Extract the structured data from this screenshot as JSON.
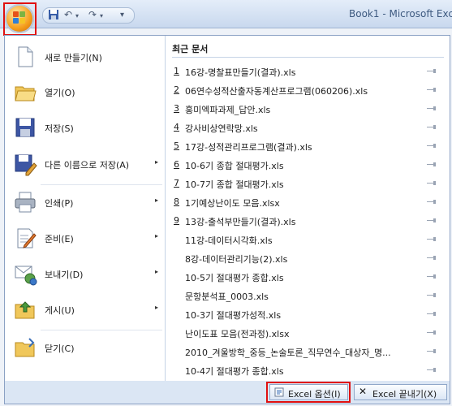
{
  "window": {
    "title": "Book1 - Microsoft Exce"
  },
  "quick_access": {
    "save_icon": "save-icon",
    "undo_icon": "undo-icon",
    "redo_icon": "redo-icon",
    "dropdown_glyph": "▾"
  },
  "left_menu": {
    "items": [
      {
        "label": "새로 만들기(N)",
        "icon": "new-document-icon",
        "has_submenu": false
      },
      {
        "label": "열기(O)",
        "icon": "folder-open-icon",
        "has_submenu": false
      },
      {
        "label": "저장(S)",
        "icon": "floppy-disk-icon",
        "has_submenu": false
      },
      {
        "label": "다른 이름으로 저장(A)",
        "icon": "save-as-icon",
        "has_submenu": true
      },
      {
        "label": "인쇄(P)",
        "icon": "printer-icon",
        "has_submenu": true
      },
      {
        "label": "준비(E)",
        "icon": "prepare-document-icon",
        "has_submenu": true
      },
      {
        "label": "보내기(D)",
        "icon": "send-icon",
        "has_submenu": true
      },
      {
        "label": "게시(U)",
        "icon": "publish-folder-icon",
        "has_submenu": true
      },
      {
        "label": "닫기(C)",
        "icon": "close-folder-icon",
        "has_submenu": false
      }
    ],
    "submenu_arrow": "▸"
  },
  "recent": {
    "header": "최근 문서",
    "items": [
      {
        "num": "1",
        "name": "16강-명찰표만들기(결과).xls"
      },
      {
        "num": "2",
        "name": "06연수성적산출자동계산프로그램(060206).xls"
      },
      {
        "num": "3",
        "name": "홍미엑파과제_답안.xls"
      },
      {
        "num": "4",
        "name": "강사비상연락망.xls"
      },
      {
        "num": "5",
        "name": "17강-성적관리프로그램(결과).xls"
      },
      {
        "num": "6",
        "name": "10-6기 종합 절대평가.xls"
      },
      {
        "num": "7",
        "name": "10-7기 종합 절대평가.xls"
      },
      {
        "num": "8",
        "name": "1기예상난이도 모음.xlsx"
      },
      {
        "num": "9",
        "name": "13강-출석부만들기(결과).xls"
      },
      {
        "num": "",
        "name": "11강-데이터시각화.xls"
      },
      {
        "num": "",
        "name": "8강-데이터관리기능(2).xls"
      },
      {
        "num": "",
        "name": "10-5기 절대평가 종합.xls"
      },
      {
        "num": "",
        "name": "문항분석표_0003.xls"
      },
      {
        "num": "",
        "name": "10-3기 절대평가성적.xls"
      },
      {
        "num": "",
        "name": "난이도표 모음(전과정).xlsx"
      },
      {
        "num": "",
        "name": "2010_겨울방학_중등_논술토론_직무연수_대상자_명..."
      },
      {
        "num": "",
        "name": "10-4기 절대평가 종합.xls"
      }
    ]
  },
  "bottom": {
    "options_label": "Excel 옵션(I)",
    "exit_label": "Excel 끝내기(X)",
    "options_icon": "options-icon",
    "exit_icon": "close-x-icon"
  },
  "colors": {
    "highlight_box": "#e01010",
    "accent": "#f59d1a"
  }
}
